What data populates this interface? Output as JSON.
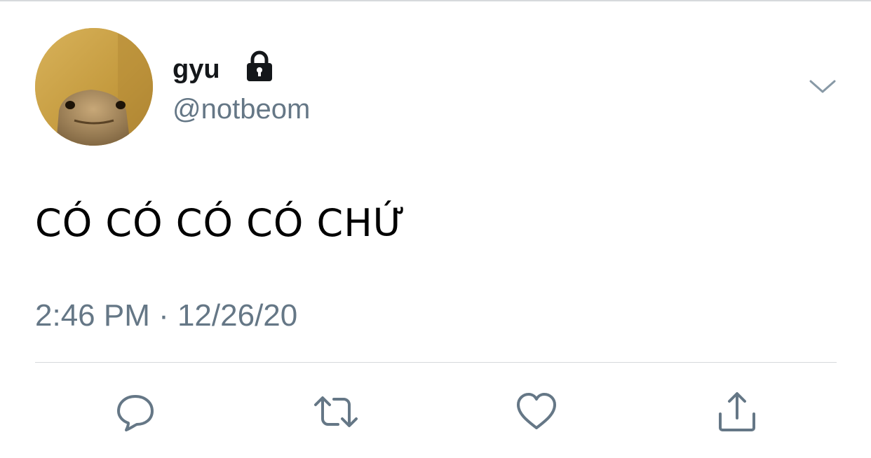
{
  "tweet": {
    "display_name": "gyu",
    "handle": "@notbeom",
    "text": "CÓ CÓ CÓ CÓ CHỨ",
    "timestamp": "2:46 PM · 12/26/20",
    "protected": true
  },
  "icons": {
    "lock": "lock-icon",
    "menu": "chevron-down-icon",
    "reply": "reply-icon",
    "retweet": "retweet-icon",
    "like": "heart-icon",
    "share": "share-icon"
  },
  "colors": {
    "text_primary": "#14171a",
    "text_secondary": "#657786",
    "icon": "#657786",
    "divider": "#d6d9dc"
  }
}
